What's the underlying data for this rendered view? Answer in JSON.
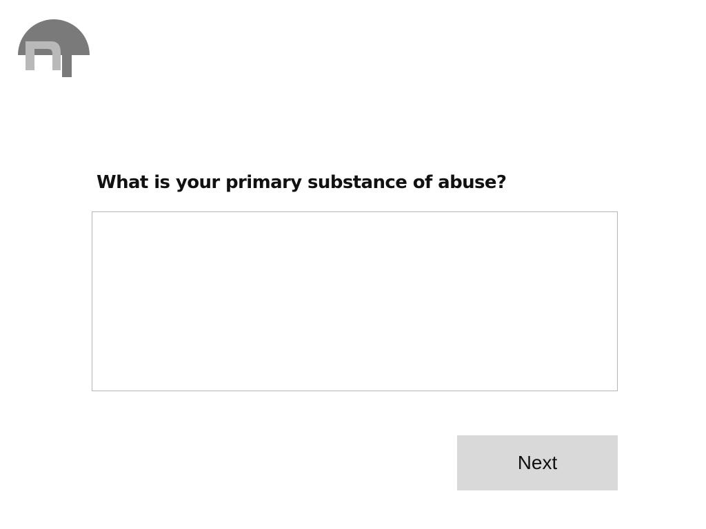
{
  "brand": {
    "logo_icon": "nt-umbrella-logo",
    "logo_letter": "n",
    "colors": {
      "dome": "#7a7a7a",
      "letter": "#b9b9b9",
      "handle": "#7a7a7a"
    }
  },
  "question": {
    "text": "What is your primary substance of abuse?"
  },
  "answer": {
    "value": "",
    "placeholder": ""
  },
  "actions": {
    "next_label": "Next"
  },
  "colors": {
    "button_background": "#d9d9d9",
    "input_border": "#b5b5b5",
    "text": "#111111"
  }
}
